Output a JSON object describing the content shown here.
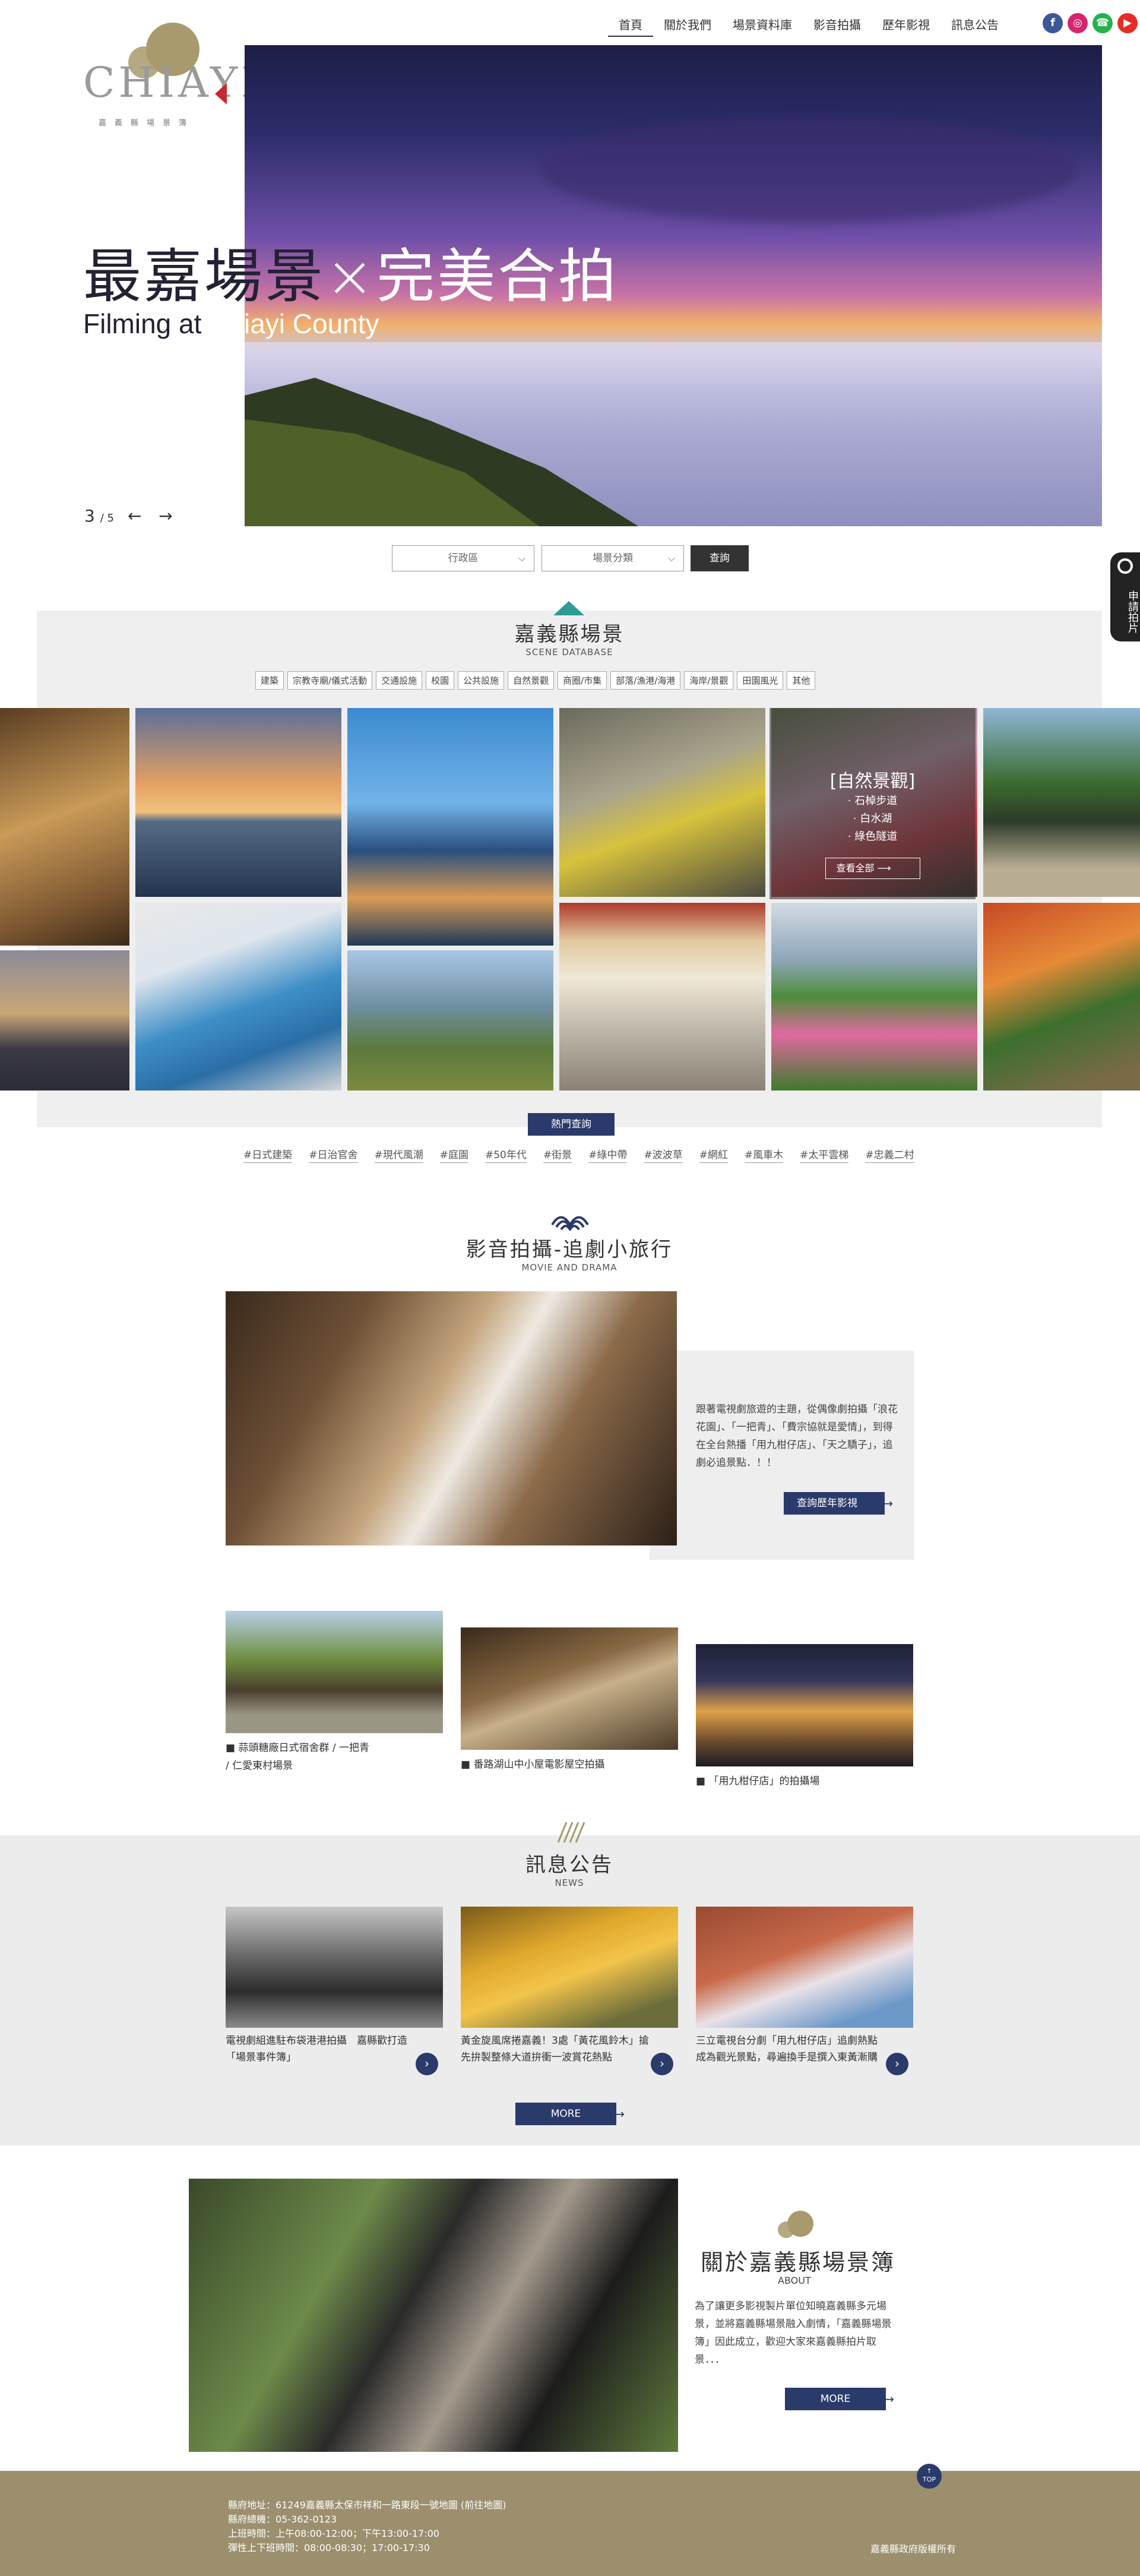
{
  "header": {
    "logo_word": "CHIAYI",
    "logo_sub": "嘉義縣場景簿",
    "nav": [
      "首頁",
      "關於我們",
      "場景資料庫",
      "影音拍攝",
      "歷年影視",
      "訊息公告"
    ],
    "social": [
      {
        "icon": "facebook-icon",
        "glyph": "f",
        "color": "#3b5998"
      },
      {
        "icon": "instagram-icon",
        "glyph": "◎",
        "color": "#d6246e"
      },
      {
        "icon": "line-icon",
        "glyph": "☎",
        "color": "#22b34c"
      },
      {
        "icon": "youtube-icon",
        "glyph": "▶",
        "color": "#e52d27"
      }
    ]
  },
  "hero": {
    "title_dark": "最嘉場景",
    "title_light": "×完美合拍",
    "sub_dark": "Filming at ",
    "sub_light": "Chiayi County",
    "slide_current": "3",
    "slide_total": "/ 5",
    "arrows": "← →"
  },
  "search": {
    "district": "行政區",
    "category": "場景分類",
    "submit": "查詢"
  },
  "apply_tab": "申請拍片",
  "scene": {
    "title": "嘉義縣場景",
    "subtitle": "SCENE DATABASE",
    "tags": [
      "建築",
      "宗教寺廟/儀式活動",
      "交通設施",
      "校園",
      "公共設施",
      "自然景觀",
      "商圈/市集",
      "部落/漁港/海港",
      "海岸/景觀",
      "田園風光",
      "其他"
    ],
    "overlay_title": "[自然景觀]",
    "overlay_items": [
      "· 石棹步道",
      "· 白水湖",
      "· 綠色隧道"
    ],
    "overlay_btn": "查看全部",
    "hot_btn": "熱門查詢",
    "hot_tags": [
      "#日式建築",
      "#日治官舍",
      "#現代風潮",
      "#庭園",
      "#50年代",
      "#街景",
      "#綠中帶",
      "#波波草",
      "#網紅",
      "#風車木",
      "#太平雲梯",
      "#忠義二村"
    ]
  },
  "movie": {
    "title": "影音拍攝-追劇小旅行",
    "subtitle": "MOVIE AND DRAMA",
    "text": "跟著電視劇旅遊的主題，從偶像劇拍攝「浪花花園」、「一把青」、「費宗協就是愛情」，到得在全台熱播「用九柑仔店」、「天之驕子」，追劇必追景點．！！",
    "btn": "查詢歷年影視",
    "captions": [
      "■ 蒜頭糖廠日式宿舍群 / 一把青\n  / 仁愛東村場景",
      "■ 番路湖山中小屋電影屋空拍攝",
      "■ 「用九柑仔店」的拍攝場"
    ]
  },
  "news": {
    "title": "訊息公告",
    "subtitle": "NEWS",
    "items": [
      "電視劇組進駐布袋港港拍攝　嘉縣歡打造「場景事件簿」",
      "黃金旋風席捲嘉義！3處「黃花風鈴木」搶先拚製整條大道拚衝一波賞花熱點",
      "三立電視台分劇「用九柑仔店」追劇熱點成為觀光景點，尋遍換手是撰入東黃漸購"
    ],
    "more": "MORE"
  },
  "about": {
    "title": "關於嘉義縣場景簿",
    "subtitle": "ABOUT",
    "text": "為了讓更多影視製片單位知曉嘉義縣多元場景，並將嘉義縣場景融入劇情，「嘉義縣場景簿」因此成立，歡迎大家來嘉義縣拍片取景．．．",
    "more": "MORE"
  },
  "footer": {
    "address": "縣府地址：61249嘉義縣太保市祥和一路東段一號地圖 (前往地圖)",
    "phone": "縣府總機：05-362-0123",
    "hours1": "上班時間：上午08:00-12:00；下午13:00-17:00",
    "hours2": "彈性上下班時間：08:00-08:30；17:00-17:30",
    "copyright": "嘉義縣政府版權所有",
    "top_label": "TOP"
  }
}
